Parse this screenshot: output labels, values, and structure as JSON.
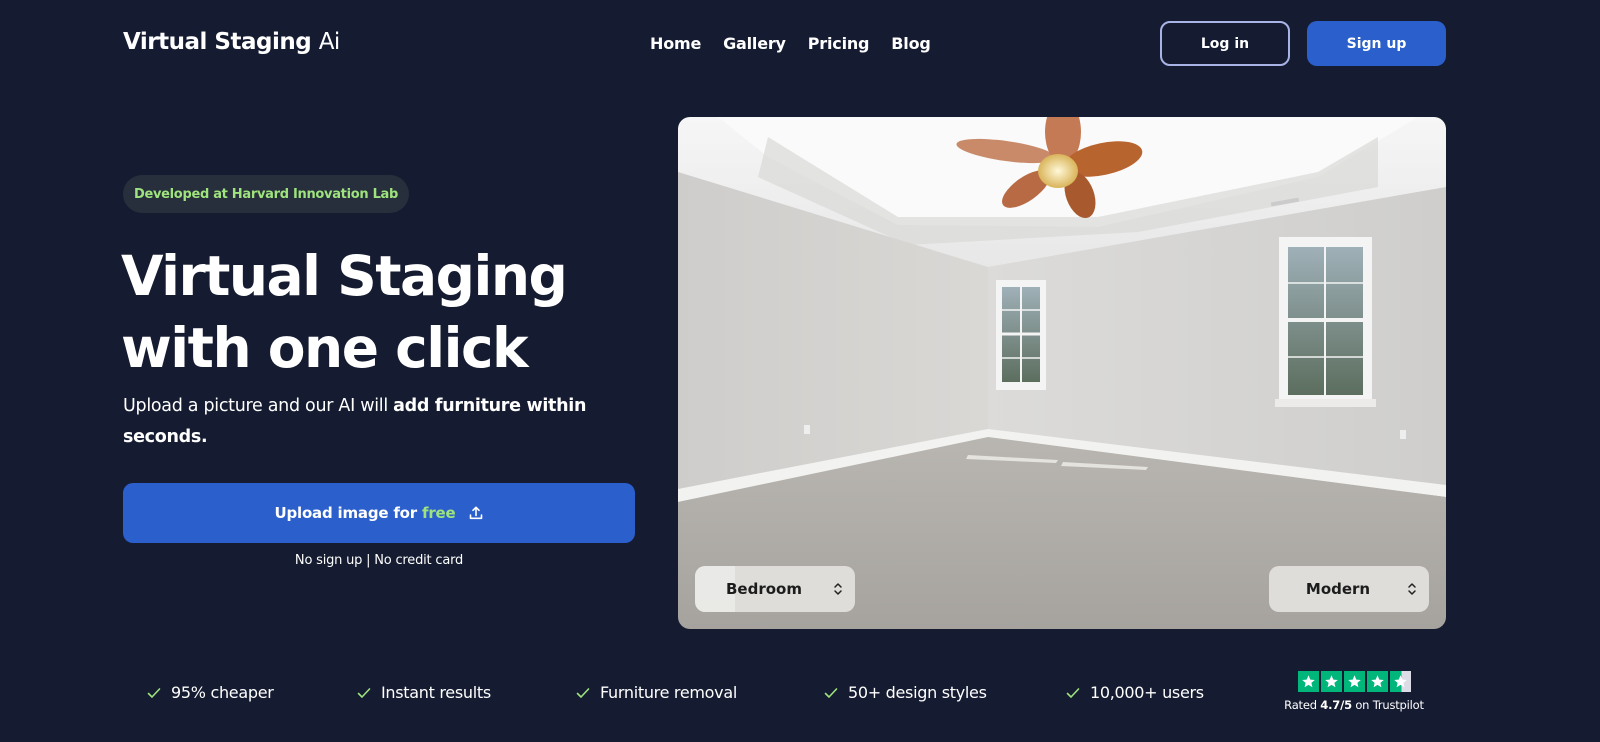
{
  "header": {
    "logo_bold": "Virtual Staging",
    "logo_light": "Ai",
    "nav": [
      {
        "label": "Home"
      },
      {
        "label": "Gallery"
      },
      {
        "label": "Pricing"
      },
      {
        "label": "Blog"
      }
    ],
    "login_label": "Log in",
    "signup_label": "Sign up"
  },
  "hero": {
    "badge": "Developed at Harvard Innovation Lab",
    "headline_line1": "Virtual Staging",
    "headline_line2": "with one click",
    "subtext_plain": "Upload a picture and our AI will ",
    "subtext_bold": "add furniture within seconds.",
    "upload_label": "Upload image for ",
    "upload_free": "free",
    "upload_icon": "upload-icon",
    "note": "No sign up | No credit card",
    "image": {
      "room_select": "Bedroom",
      "style_select": "Modern",
      "alt": "Empty bedroom with ceiling fan, two windows, carpet floor"
    }
  },
  "features": [
    {
      "icon": "check-icon",
      "label": "95% cheaper"
    },
    {
      "icon": "check-icon",
      "label": "Instant results"
    },
    {
      "icon": "check-icon",
      "label": "Furniture removal"
    },
    {
      "icon": "check-icon",
      "label": "50+ design styles"
    },
    {
      "icon": "check-icon",
      "label": "10,000+ users"
    }
  ],
  "trustpilot": {
    "rating": "4.7/5",
    "prefix": "Rated ",
    "suffix": " on Trustpilot",
    "stars": 4.7,
    "max_stars": 5
  },
  "colors": {
    "background": "#151b31",
    "primary": "#2b5fcc",
    "accent_green": "#9ee37d",
    "trustpilot_green": "#00b67a"
  }
}
